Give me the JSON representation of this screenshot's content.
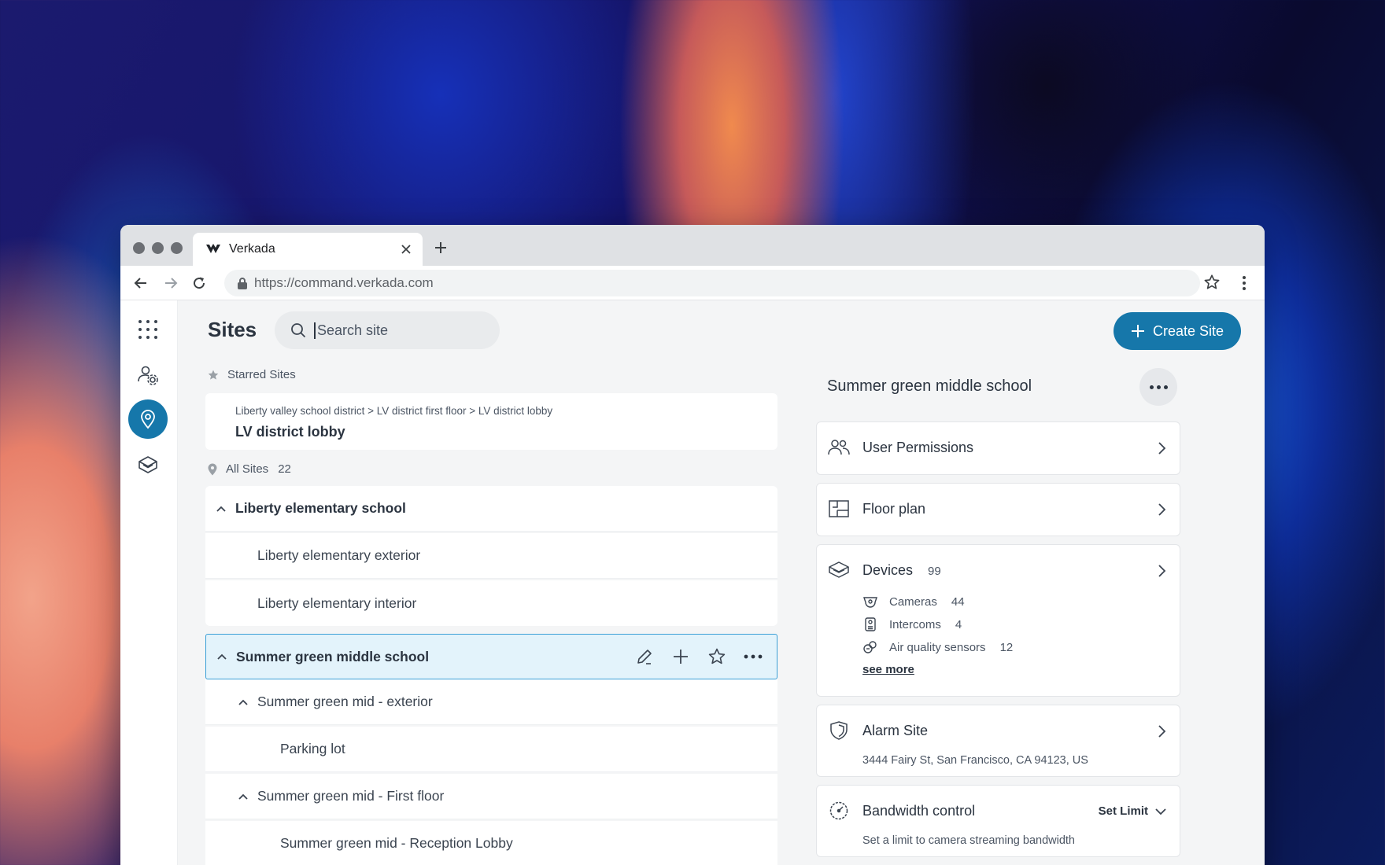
{
  "browser": {
    "tab_title": "Verkada",
    "url": "https://command.verkada.com"
  },
  "header": {
    "title": "Sites",
    "search_placeholder": "Search site",
    "create_label": "Create Site"
  },
  "starred": {
    "label": "Starred Sites",
    "breadcrumb": "Liberty valley school district > LV district first floor > LV district lobby",
    "name": "LV district lobby"
  },
  "all_sites": {
    "label": "All Sites",
    "count": "22"
  },
  "tree": [
    {
      "label": "Liberty elementary school",
      "level": 0,
      "expanded": true
    },
    {
      "label": "Liberty elementary exterior",
      "level": 1
    },
    {
      "label": "Liberty elementary interior",
      "level": 1
    },
    {
      "label": "Summer green middle school",
      "level": 0,
      "expanded": true,
      "selected": true
    },
    {
      "label": "Summer green mid - exterior",
      "level": 1,
      "expanded": true
    },
    {
      "label": "Parking lot",
      "level": 2
    },
    {
      "label": "Summer green mid - First floor",
      "level": 1,
      "expanded": true
    },
    {
      "label": "Summer green mid - Reception Lobby",
      "level": 2
    }
  ],
  "detail": {
    "title": "Summer green middle school",
    "user_permissions": "User Permissions",
    "floor_plan": "Floor plan",
    "devices": {
      "label": "Devices",
      "count": "99",
      "items": [
        {
          "label": "Cameras",
          "count": "44",
          "icon": "camera-icon"
        },
        {
          "label": "Intercoms",
          "count": "4",
          "icon": "intercom-icon"
        },
        {
          "label": "Air quality sensors",
          "count": "12",
          "icon": "air-sensor-icon"
        }
      ],
      "see_more": "see more"
    },
    "alarm": {
      "label": "Alarm Site",
      "address": "3444 Fairy St, San Francisco, CA 94123, US"
    },
    "bandwidth": {
      "label": "Bandwidth control",
      "action": "Set Limit",
      "description": "Set a limit to camera streaming bandwidth"
    }
  },
  "colors": {
    "accent": "#1677aa",
    "selected_row_bg": "#e3f3fb",
    "selected_row_border": "#3a9fd6"
  }
}
